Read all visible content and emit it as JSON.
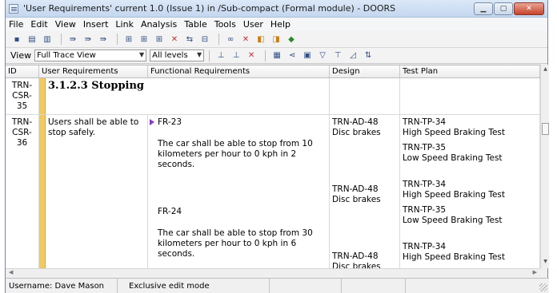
{
  "window": {
    "title": "'User Requirements' current 1.0 (Issue 1) in /Sub-compact (Formal module) - DOORS"
  },
  "menu": [
    "File",
    "Edit",
    "View",
    "Insert",
    "Link",
    "Analysis",
    "Table",
    "Tools",
    "User",
    "Help"
  ],
  "viewbar": {
    "label": "View",
    "view_value": "Full Trace View",
    "levels_value": "All levels"
  },
  "columns": {
    "id": "ID",
    "user_req": "User Requirements",
    "functional": "Functional Requirements",
    "design": "Design",
    "test_plan": "Test Plan"
  },
  "rows": [
    {
      "id": "TRN-CSR-35",
      "heading": "3.1.2.3 Stopping"
    },
    {
      "id": "TRN-CSR-36",
      "user_req": "Users shall be able to stop safely.",
      "fr1_id": "FR-23",
      "fr1_text": "The car shall be able to stop from 10 kilometers per hour to 0 kph in 2 seconds.",
      "d1_id": "TRN-AD-48",
      "d1_text": "Disc brakes",
      "t1_id": "TRN-TP-34",
      "t1_text": "High Speed Braking Test",
      "t2_id": "TRN-TP-35",
      "t2_text": "Low Speed Braking Test",
      "fr2_id": "FR-24",
      "fr2_text": "The car shall be able to stop from 30 kilometers per hour to 0 kph in 6 seconds.",
      "d2_id": "TRN-AD-48",
      "d2_text": "Disc brakes",
      "t3_id": "TRN-TP-34",
      "t3_text": "High Speed Braking Test",
      "t4_id": "TRN-TP-35",
      "t4_text": "Low Speed Braking Test",
      "d3_id": "TRN-AD-48",
      "d3_text": "Disc brakes",
      "t5_id": "TRN-TP-34",
      "t5_text": "High Speed Braking Test"
    }
  ],
  "status": {
    "username": "Username: Dave Mason",
    "mode": "Exclusive edit mode"
  }
}
